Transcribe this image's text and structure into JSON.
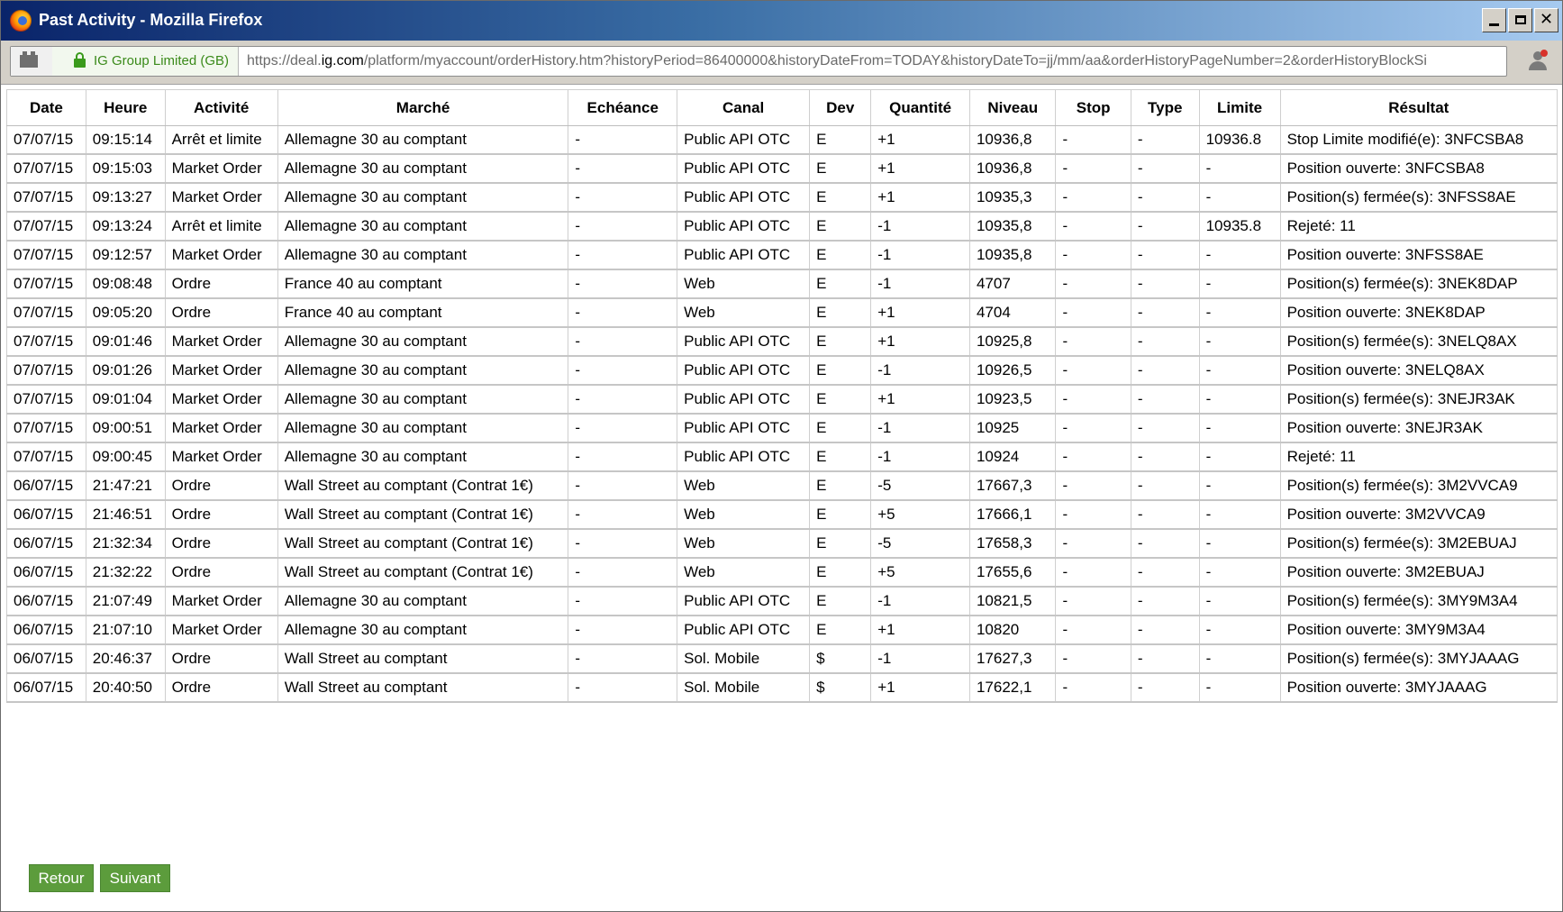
{
  "window": {
    "title": "Past Activity - Mozilla Firefox",
    "minimize_glyph": "",
    "maximize_glyph": "",
    "close_glyph": "✕"
  },
  "urlbar": {
    "identity": "IG Group Limited (GB)",
    "url_prefix": "https://deal.",
    "url_host": "ig.com",
    "url_rest": "/platform/myaccount/orderHistory.htm?historyPeriod=86400000&historyDateFrom=TODAY&historyDateTo=jj/mm/aa&orderHistoryPageNumber=2&orderHistoryBlockSi"
  },
  "icons": {
    "browser": "firefox-icon",
    "site": "site-info-icon",
    "lock": "lock-icon",
    "profile": "profile-notification-icon"
  },
  "colors": {
    "button_green": "#5c9c3c",
    "identity_green": "#3a8a1a",
    "title_gradient_start": "#0a246a"
  },
  "table": {
    "headers": [
      "Date",
      "Heure",
      "Activité",
      "Marché",
      "Echéance",
      "Canal",
      "Dev",
      "Quantité",
      "Niveau",
      "Stop",
      "Type",
      "Limite",
      "Résultat"
    ],
    "rows": [
      [
        "07/07/15",
        "09:15:14",
        "Arrêt et limite",
        "Allemagne 30 au comptant",
        "-",
        "Public API OTC",
        "E",
        "+1",
        "10936,8",
        "-",
        "-",
        "10936.8",
        "Stop Limite modifié(e): 3NFCSBA8"
      ],
      [
        "07/07/15",
        "09:15:03",
        "Market Order",
        "Allemagne 30 au comptant",
        "-",
        "Public API OTC",
        "E",
        "+1",
        "10936,8",
        "-",
        "-",
        "-",
        "Position ouverte: 3NFCSBA8"
      ],
      [
        "07/07/15",
        "09:13:27",
        "Market Order",
        "Allemagne 30 au comptant",
        "-",
        "Public API OTC",
        "E",
        "+1",
        "10935,3",
        "-",
        "-",
        "-",
        "Position(s) fermée(s): 3NFSS8AE"
      ],
      [
        "07/07/15",
        "09:13:24",
        "Arrêt et limite",
        "Allemagne 30 au comptant",
        "-",
        "Public API OTC",
        "E",
        "-1",
        "10935,8",
        "-",
        "-",
        "10935.8",
        "Rejeté: 11"
      ],
      [
        "07/07/15",
        "09:12:57",
        "Market Order",
        "Allemagne 30 au comptant",
        "-",
        "Public API OTC",
        "E",
        "-1",
        "10935,8",
        "-",
        "-",
        "-",
        "Position ouverte: 3NFSS8AE"
      ],
      [
        "07/07/15",
        "09:08:48",
        "Ordre",
        "France 40 au comptant",
        "-",
        "Web",
        "E",
        "-1",
        "4707",
        "-",
        "-",
        "-",
        "Position(s) fermée(s): 3NEK8DAP"
      ],
      [
        "07/07/15",
        "09:05:20",
        "Ordre",
        "France 40 au comptant",
        "-",
        "Web",
        "E",
        "+1",
        "4704",
        "-",
        "-",
        "-",
        "Position ouverte: 3NEK8DAP"
      ],
      [
        "07/07/15",
        "09:01:46",
        "Market Order",
        "Allemagne 30 au comptant",
        "-",
        "Public API OTC",
        "E",
        "+1",
        "10925,8",
        "-",
        "-",
        "-",
        "Position(s) fermée(s): 3NELQ8AX"
      ],
      [
        "07/07/15",
        "09:01:26",
        "Market Order",
        "Allemagne 30 au comptant",
        "-",
        "Public API OTC",
        "E",
        "-1",
        "10926,5",
        "-",
        "-",
        "-",
        "Position ouverte: 3NELQ8AX"
      ],
      [
        "07/07/15",
        "09:01:04",
        "Market Order",
        "Allemagne 30 au comptant",
        "-",
        "Public API OTC",
        "E",
        "+1",
        "10923,5",
        "-",
        "-",
        "-",
        "Position(s) fermée(s): 3NEJR3AK"
      ],
      [
        "07/07/15",
        "09:00:51",
        "Market Order",
        "Allemagne 30 au comptant",
        "-",
        "Public API OTC",
        "E",
        "-1",
        "10925",
        "-",
        "-",
        "-",
        "Position ouverte: 3NEJR3AK"
      ],
      [
        "07/07/15",
        "09:00:45",
        "Market Order",
        "Allemagne 30 au comptant",
        "-",
        "Public API OTC",
        "E",
        "-1",
        "10924",
        "-",
        "-",
        "-",
        "Rejeté: 11"
      ],
      [
        "06/07/15",
        "21:47:21",
        "Ordre",
        "Wall Street au comptant (Contrat 1€)",
        "-",
        "Web",
        "E",
        "-5",
        "17667,3",
        "-",
        "-",
        "-",
        "Position(s) fermée(s): 3M2VVCA9"
      ],
      [
        "06/07/15",
        "21:46:51",
        "Ordre",
        "Wall Street au comptant (Contrat 1€)",
        "-",
        "Web",
        "E",
        "+5",
        "17666,1",
        "-",
        "-",
        "-",
        "Position ouverte: 3M2VVCA9"
      ],
      [
        "06/07/15",
        "21:32:34",
        "Ordre",
        "Wall Street au comptant (Contrat 1€)",
        "-",
        "Web",
        "E",
        "-5",
        "17658,3",
        "-",
        "-",
        "-",
        "Position(s) fermée(s): 3M2EBUAJ"
      ],
      [
        "06/07/15",
        "21:32:22",
        "Ordre",
        "Wall Street au comptant (Contrat 1€)",
        "-",
        "Web",
        "E",
        "+5",
        "17655,6",
        "-",
        "-",
        "-",
        "Position ouverte: 3M2EBUAJ"
      ],
      [
        "06/07/15",
        "21:07:49",
        "Market Order",
        "Allemagne 30 au comptant",
        "-",
        "Public API OTC",
        "E",
        "-1",
        "10821,5",
        "-",
        "-",
        "-",
        "Position(s) fermée(s): 3MY9M3A4"
      ],
      [
        "06/07/15",
        "21:07:10",
        "Market Order",
        "Allemagne 30 au comptant",
        "-",
        "Public API OTC",
        "E",
        "+1",
        "10820",
        "-",
        "-",
        "-",
        "Position ouverte: 3MY9M3A4"
      ],
      [
        "06/07/15",
        "20:46:37",
        "Ordre",
        "Wall Street au comptant",
        "-",
        "Sol. Mobile",
        "$",
        "-1",
        "17627,3",
        "-",
        "-",
        "-",
        "Position(s) fermée(s): 3MYJAAAG"
      ],
      [
        "06/07/15",
        "20:40:50",
        "Ordre",
        "Wall Street au comptant",
        "-",
        "Sol. Mobile",
        "$",
        "+1",
        "17622,1",
        "-",
        "-",
        "-",
        "Position ouverte: 3MYJAAAG"
      ]
    ]
  },
  "footer": {
    "back_label": "Retour",
    "next_label": "Suivant"
  }
}
